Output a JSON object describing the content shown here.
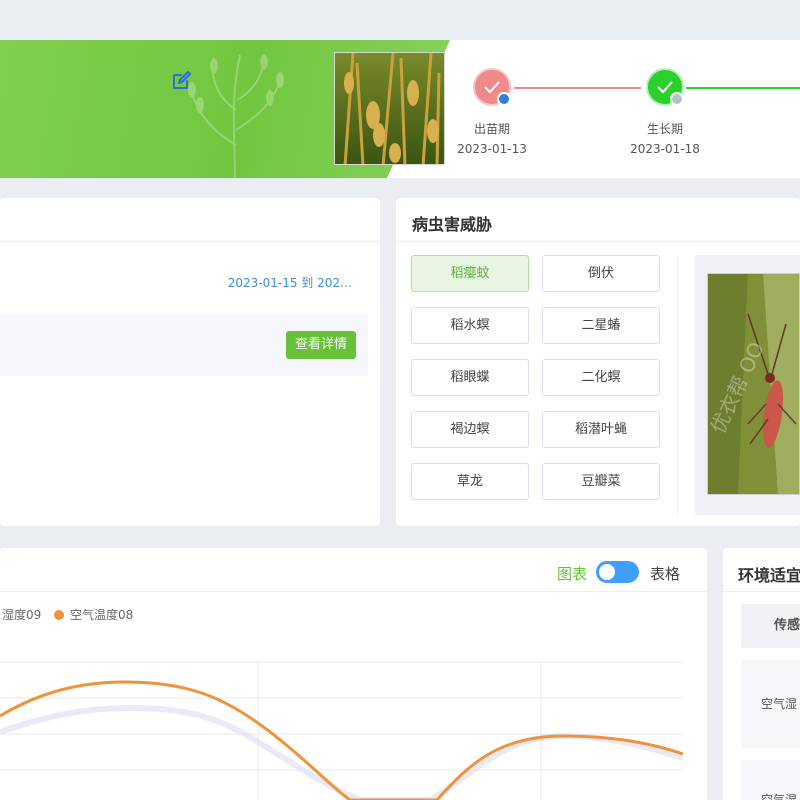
{
  "stages": [
    {
      "name": "出苗期",
      "date": "2023-01-13",
      "color": "#f08a8a"
    },
    {
      "name": "生长期",
      "date": "2023-01-18",
      "color": "#2ad12a"
    }
  ],
  "record": {
    "date_range": "2023-01-15 到 202…",
    "detail_label": "查看详情"
  },
  "pest": {
    "title": "病虫害威胁",
    "items": [
      "稻瘿蚊",
      "倒伏",
      "稻水螟",
      "二星蝽",
      "稻眼蝶",
      "二化螟",
      "褐边螟",
      "稻潜叶蝇",
      "草龙",
      "豆瓣菜"
    ],
    "active_index": 0,
    "watermark": "优衣帮 OO"
  },
  "chart_panel": {
    "view_chart": "图表",
    "view_table": "表格",
    "chart_data": {
      "type": "line",
      "series": [
        {
          "name": "湿度09",
          "color": "#c9c2e8"
        },
        {
          "name": "空气温度08",
          "color": "#f0923a"
        }
      ]
    }
  },
  "env": {
    "title": "环境适宜",
    "header_cell": "传感",
    "row1": "空气湿",
    "row2": "空气湿"
  },
  "colors": {
    "brand_green": "#67c23a",
    "toggle_blue": "#409eff",
    "link_blue": "#3a8ed8"
  }
}
